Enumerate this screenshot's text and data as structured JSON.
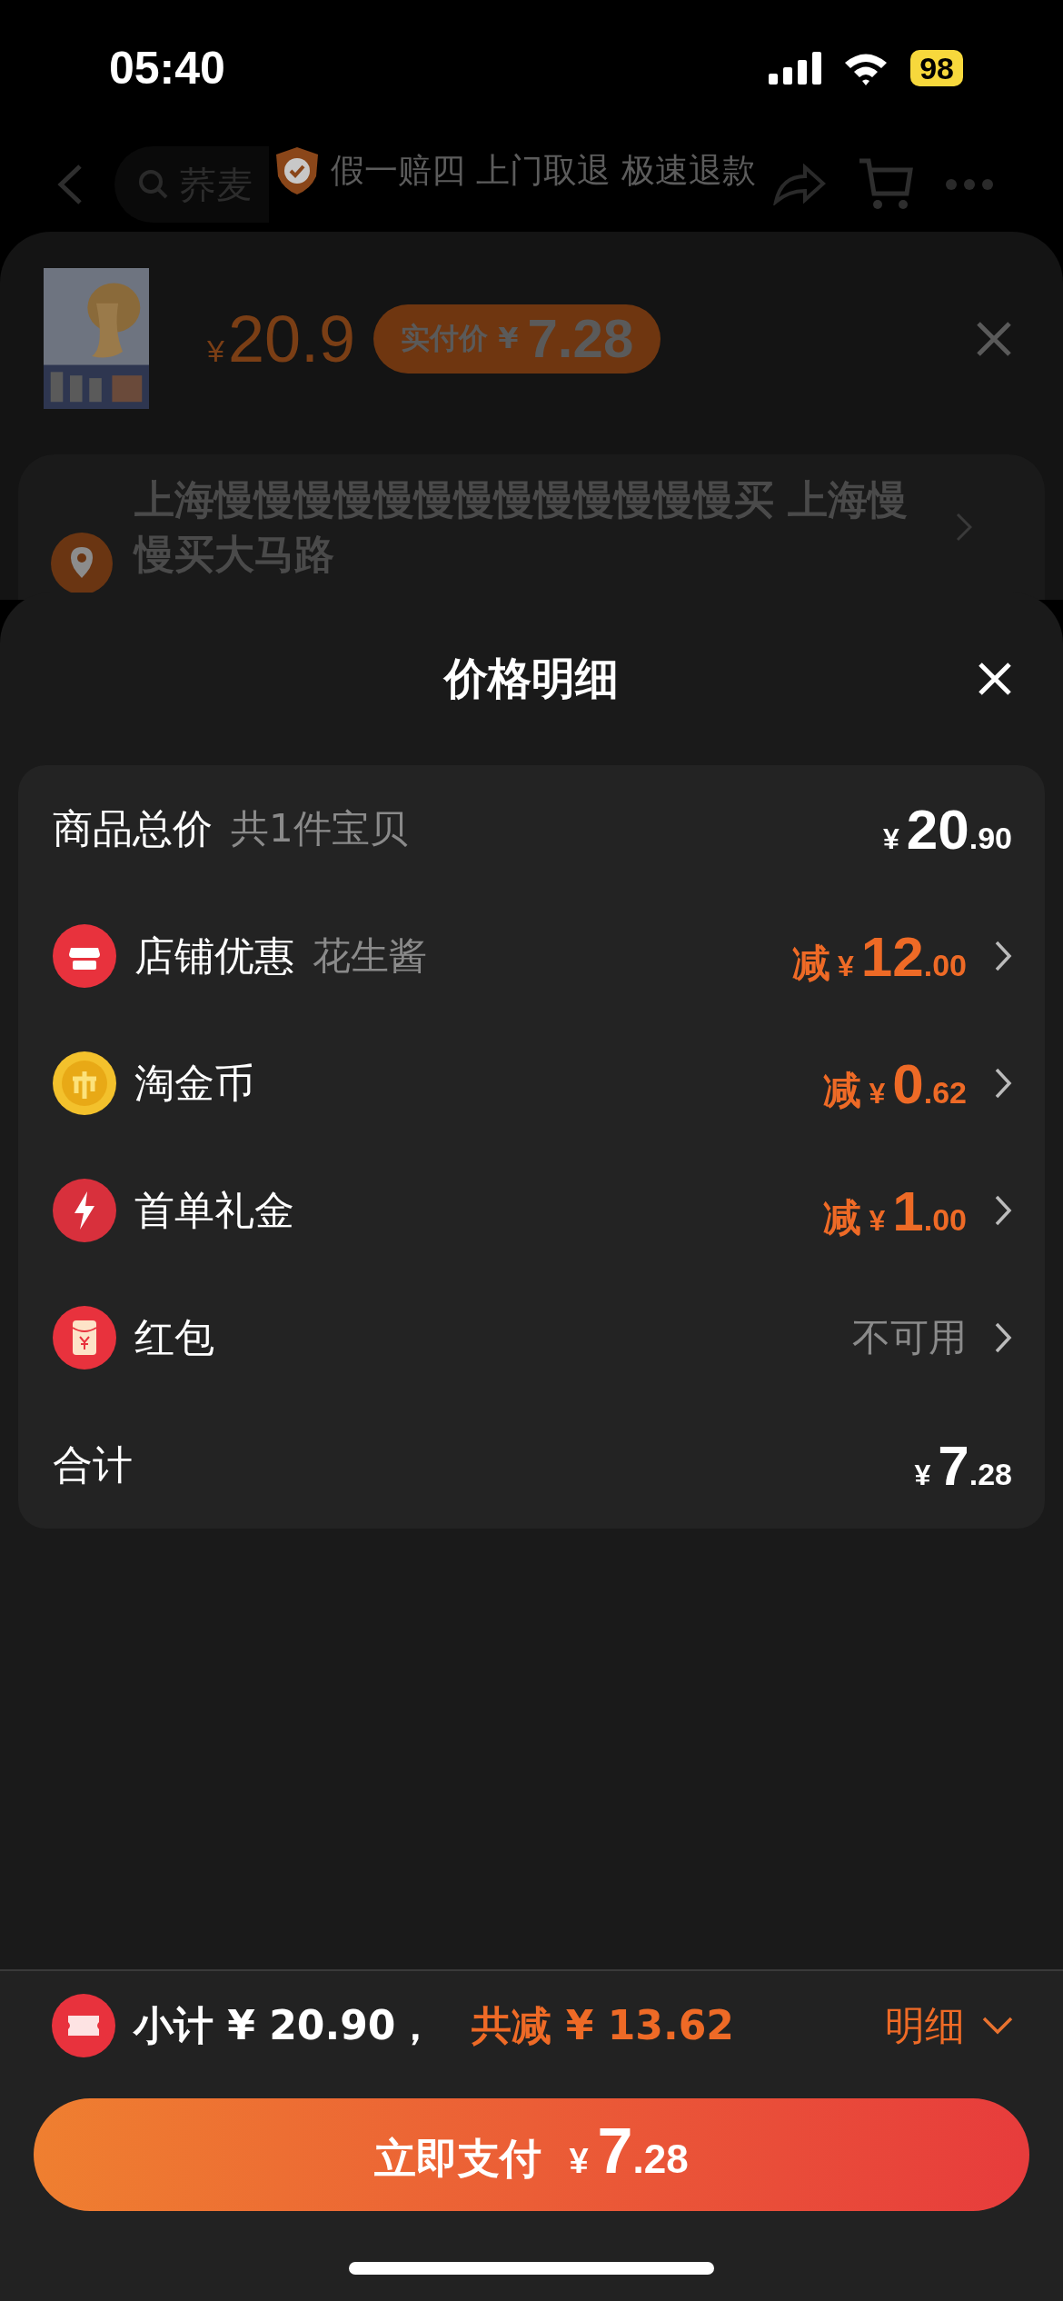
{
  "status_bar": {
    "time": "05:40",
    "battery": "98"
  },
  "nav": {
    "search": {
      "placeholder": "荞麦"
    },
    "banner": "假一赔四 上门取退 极速退款"
  },
  "product": {
    "symbol": "¥",
    "price": "20.9",
    "pay_label": "实付价",
    "pay_symbol": "¥",
    "pay_price": "7.28"
  },
  "address": {
    "text": "上海慢慢慢慢慢慢慢慢慢慢慢慢慢买 上海慢慢买大马路"
  },
  "sheet": {
    "title": "价格明细"
  },
  "rows": [
    {
      "kind": "total",
      "label": "商品总价",
      "note": "共1件宝贝",
      "symbol": "¥",
      "int": "20",
      "dec": ".90"
    },
    {
      "kind": "discount",
      "label": "店铺优惠",
      "note": "花生酱",
      "prefix": "减",
      "symbol": "¥",
      "int": "12",
      "dec": ".00"
    },
    {
      "kind": "discount",
      "label": "淘金币",
      "prefix": "减",
      "symbol": "¥",
      "int": "0",
      "dec": ".62"
    },
    {
      "kind": "discount",
      "label": "首单礼金",
      "prefix": "减",
      "symbol": "¥",
      "int": "1",
      "dec": ".00"
    },
    {
      "kind": "unavailable",
      "label": "红包",
      "status": "不可用"
    },
    {
      "kind": "total",
      "label": "合计",
      "symbol": "¥",
      "int": "7",
      "dec": ".28"
    }
  ],
  "footer": {
    "subtotal": "小计 ¥ 20.90，",
    "saved": "共减 ¥ 13.62",
    "details": "明细",
    "pay_label": "立即支付",
    "pay_symbol": "¥",
    "pay_int": "7",
    "pay_dec": ".28"
  }
}
